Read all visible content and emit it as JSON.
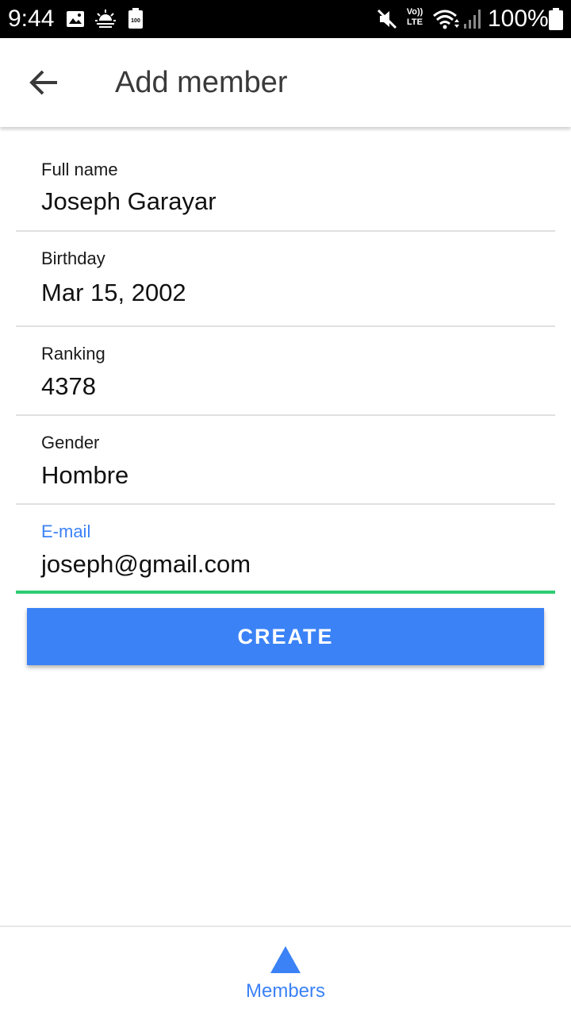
{
  "status_bar": {
    "time": "9:44",
    "volte": "Vo)) LTE",
    "battery_percent": "100%",
    "battery_small_label": "100",
    "icons": [
      "image-icon",
      "weather-icon",
      "battery-saver-icon",
      "mute-icon",
      "volte-icon",
      "wifi-icon",
      "signal-icon",
      "battery-icon"
    ]
  },
  "app_bar": {
    "title": "Add member",
    "back_icon": "arrow-back-icon"
  },
  "form": {
    "fields": [
      {
        "label": "Full name",
        "value": "Joseph Garayar"
      },
      {
        "label": "Birthday",
        "value": "Mar 15, 2002"
      },
      {
        "label": "Ranking",
        "value": "4378"
      },
      {
        "label": "Gender",
        "value": "Hombre"
      },
      {
        "label": "E-mail",
        "value": "joseph@gmail.com"
      }
    ],
    "create_label": "CREATE"
  },
  "bottom_nav": {
    "items": [
      {
        "label": "Members",
        "icon": "triangle-icon",
        "active": true
      }
    ]
  },
  "colors": {
    "accent": "#3b82f6",
    "focus_underline": "#2ecc71",
    "divider": "#e0e0e0",
    "status_bar": "#000000"
  }
}
